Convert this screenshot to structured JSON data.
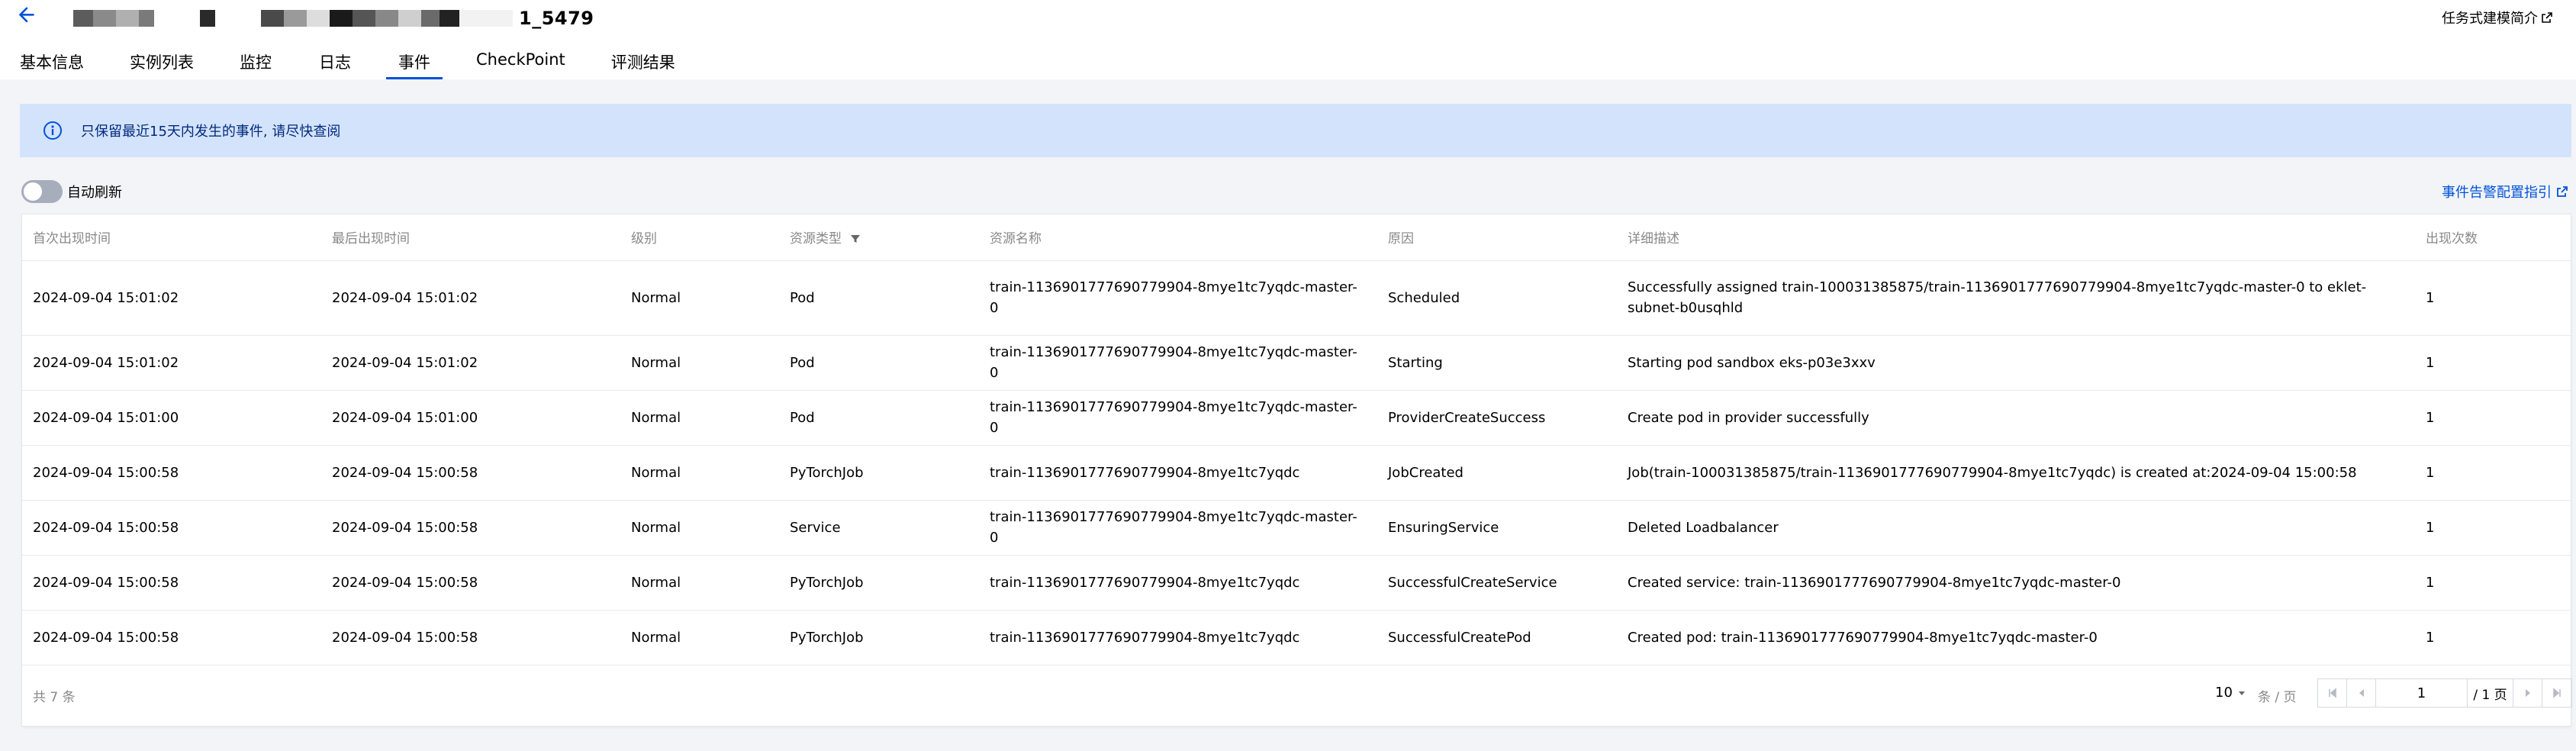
{
  "header": {
    "title_suffix": "1_5479",
    "intro_link": "任务式建模简介",
    "tabs": [
      {
        "label": "基本信息",
        "active": false
      },
      {
        "label": "实例列表",
        "active": false
      },
      {
        "label": "监控",
        "active": false
      },
      {
        "label": "日志",
        "active": false
      },
      {
        "label": "事件",
        "active": true
      },
      {
        "label": "CheckPoint",
        "active": false
      },
      {
        "label": "评测结果",
        "active": false
      }
    ]
  },
  "alert": {
    "text": "只保留最近15天内发生的事件, 请尽快查阅",
    "icon": "info-icon"
  },
  "controls": {
    "auto_refresh_label": "自动刷新",
    "auto_refresh_on": false,
    "guide_link": "事件告警配置指引"
  },
  "table": {
    "columns": [
      "首次出现时间",
      "最后出现时间",
      "级别",
      "资源类型",
      "资源名称",
      "原因",
      "详细描述",
      "出现次数"
    ],
    "rows": [
      [
        "2024-09-04 15:01:02",
        "2024-09-04 15:01:02",
        "Normal",
        "Pod",
        "train-1136901777690779904-8mye1tc7yqdc-master-0",
        "Scheduled",
        "Successfully assigned train-100031385875/train-1136901777690779904-8mye1tc7yqdc-master-0 to eklet-subnet-b0usqhld",
        "1"
      ],
      [
        "2024-09-04 15:01:02",
        "2024-09-04 15:01:02",
        "Normal",
        "Pod",
        "train-1136901777690779904-8mye1tc7yqdc-master-0",
        "Starting",
        "Starting pod sandbox eks-p03e3xxv",
        "1"
      ],
      [
        "2024-09-04 15:01:00",
        "2024-09-04 15:01:00",
        "Normal",
        "Pod",
        "train-1136901777690779904-8mye1tc7yqdc-master-0",
        "ProviderCreateSuccess",
        "Create pod in provider successfully",
        "1"
      ],
      [
        "2024-09-04 15:00:58",
        "2024-09-04 15:00:58",
        "Normal",
        "PyTorchJob",
        "train-1136901777690779904-8mye1tc7yqdc",
        "JobCreated",
        "Job(train-100031385875/train-1136901777690779904-8mye1tc7yqdc) is created at:2024-09-04 15:00:58",
        "1"
      ],
      [
        "2024-09-04 15:00:58",
        "2024-09-04 15:00:58",
        "Normal",
        "Service",
        "train-1136901777690779904-8mye1tc7yqdc-master-0",
        "EnsuringService",
        "Deleted Loadbalancer",
        "1"
      ],
      [
        "2024-09-04 15:00:58",
        "2024-09-04 15:00:58",
        "Normal",
        "PyTorchJob",
        "train-1136901777690779904-8mye1tc7yqdc",
        "SuccessfulCreateService",
        "Created service: train-1136901777690779904-8mye1tc7yqdc-master-0",
        "1"
      ],
      [
        "2024-09-04 15:00:58",
        "2024-09-04 15:00:58",
        "Normal",
        "PyTorchJob",
        "train-1136901777690779904-8mye1tc7yqdc",
        "SuccessfulCreatePod",
        "Created pod: train-1136901777690779904-8mye1tc7yqdc-master-0",
        "1"
      ]
    ]
  },
  "pagination": {
    "total": "共 7 条",
    "page_size": "10",
    "per_page": "条 / 页",
    "current_page": "1",
    "total_pages": "/ 1 页"
  },
  "colors": {
    "accent": "#0052d9",
    "alert_bg": "#d4e3fc",
    "page_bg": "#f3f4f7"
  }
}
